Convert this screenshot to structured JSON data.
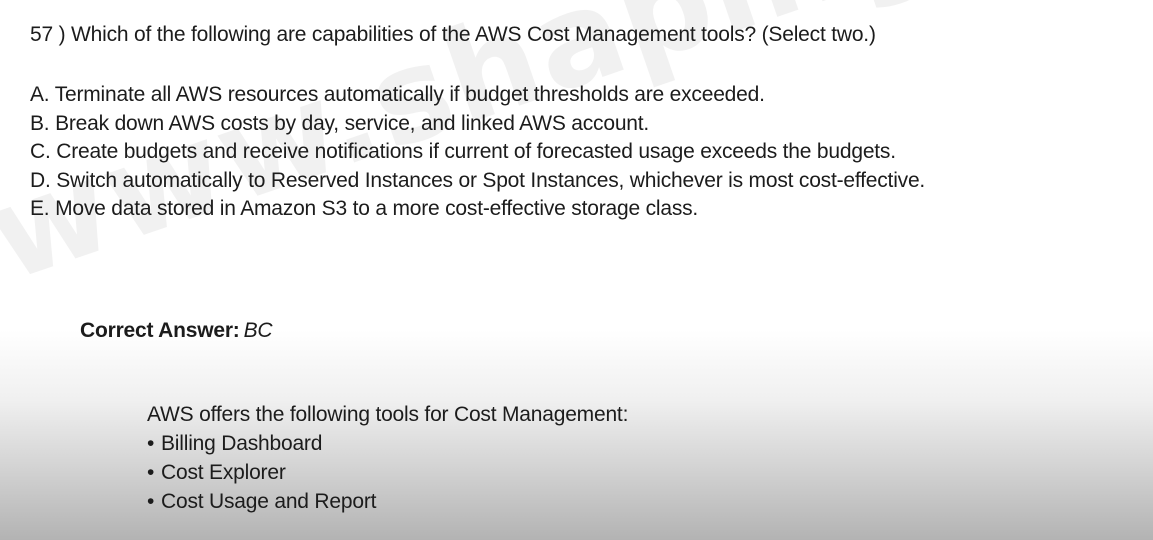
{
  "watermark": "www.shapingpixel.com",
  "question": {
    "text": "57 ) Which of the following are capabilities of the AWS Cost Management tools? (Select two.)"
  },
  "options": [
    "A. Terminate all AWS resources automatically if budget thresholds are exceeded.",
    "B. Break down AWS costs by day, service, and linked AWS account.",
    "C. Create budgets and receive notifications if current of forecasted usage exceeds the budgets.",
    "D. Switch automatically to Reserved Instances or Spot Instances, whichever is most cost-effective.",
    "E. Move data stored in Amazon S3 to a more cost-effective storage class."
  ],
  "answer": {
    "label": "Correct Answer:",
    "value": "BC"
  },
  "explanation": {
    "intro": "AWS offers the following tools for Cost Management:",
    "bullet": "•",
    "items": [
      "Billing Dashboard",
      "Cost Explorer",
      "Cost Usage and Report"
    ]
  }
}
